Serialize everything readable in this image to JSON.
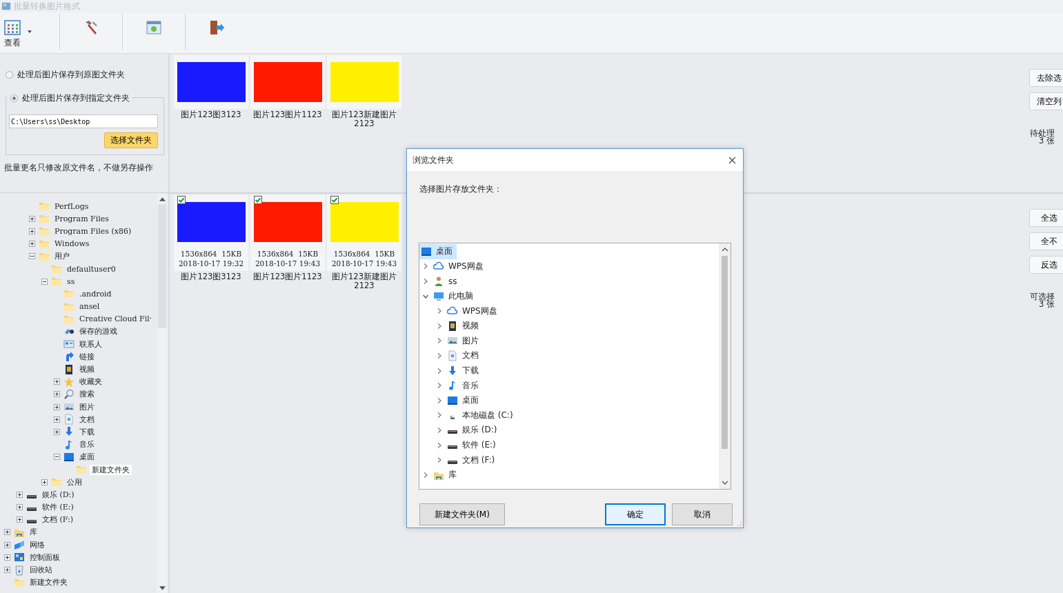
{
  "window": {
    "title": "批量转换图片格式"
  },
  "toolbar": {
    "items": [
      {
        "kind": "grid",
        "label": "查看",
        "dropdown": true
      },
      {
        "kind": "hammer"
      },
      {
        "kind": "board"
      },
      {
        "kind": "exit"
      }
    ]
  },
  "save_options": [
    {
      "label": "处理后图片保存到原图文件夹",
      "selected": false
    },
    {
      "label": "处理后图片保存到指定文件夹",
      "selected": true
    }
  ],
  "folder_field": {
    "value": "C:\\Users\\ss\\Desktop"
  },
  "choose_button": "选择文件夹",
  "note": "批量更名只修改原文件名，不做另存操作",
  "tree": {
    "items": [
      {
        "children": [
          {
            "children": [
              {
                "label": "PerfLogs",
                "kind": "folder",
                "selected": false
              },
              {
                "label": "Program Files",
                "kind": "folder",
                "expanded": false,
                "selected": false
              },
              {
                "label": "Program Files (x86)",
                "kind": "folder",
                "expanded": false,
                "selected": false
              },
              {
                "label": "Windows",
                "kind": "folder",
                "expanded": false,
                "selected": false
              },
              {
                "label": "用户",
                "kind": "folder",
                "expanded": true,
                "selected": false,
                "children": [
                  {
                    "label": "defaultuser0",
                    "kind": "folder",
                    "selected": false
                  },
                  {
                    "label": "ss",
                    "kind": "folder",
                    "expanded": true,
                    "selected": false,
                    "children": [
                      {
                        "label": ".android",
                        "kind": "folder",
                        "selected": false
                      },
                      {
                        "label": "ansel",
                        "kind": "folder",
                        "selected": false
                      },
                      {
                        "label": "Creative Cloud Fil·",
                        "kind": "folder",
                        "selected": false
                      },
                      {
                        "label": "保存的游戏",
                        "kind": "game",
                        "selected": false
                      },
                      {
                        "label": "联系人",
                        "kind": "contact",
                        "selected": false
                      },
                      {
                        "label": "链接",
                        "kind": "link",
                        "selected": false
                      },
                      {
                        "label": "视频",
                        "kind": "video",
                        "selected": false
                      },
                      {
                        "label": "收藏夹",
                        "kind": "star",
                        "expanded": false,
                        "selected": false
                      },
                      {
                        "label": "搜索",
                        "kind": "search",
                        "expanded": false,
                        "selected": false
                      },
                      {
                        "label": "图片",
                        "kind": "picture",
                        "expanded": false,
                        "selected": false
                      },
                      {
                        "label": "文档",
                        "kind": "doc",
                        "expanded": false,
                        "selected": false
                      },
                      {
                        "label": "下载",
                        "kind": "download",
                        "expanded": false,
                        "selected": false
                      },
                      {
                        "label": "音乐",
                        "kind": "music",
                        "selected": false
                      },
                      {
                        "label": "桌面",
                        "kind": "desktop",
                        "expanded": true,
                        "selected": false,
                        "children": [
                          {
                            "label": "新建文件夹",
                            "kind": "folder",
                            "selected": true
                          }
                        ]
                      }
                    ]
                  },
                  {
                    "label": "公用",
                    "kind": "folder",
                    "expanded": false,
                    "selected": false
                  }
                ]
              }
            ]
          },
          {
            "label": "娱乐 (D:)",
            "kind": "drive",
            "expanded": false,
            "selected": false
          },
          {
            "label": "软件 (E:)",
            "kind": "drive",
            "expanded": false,
            "selected": false
          },
          {
            "label": "文档 (F:)",
            "kind": "drive",
            "expanded": false,
            "selected": false
          }
        ]
      },
      {
        "label": "库",
        "kind": "library",
        "expanded": false,
        "selected": false
      },
      {
        "label": "网络",
        "kind": "network",
        "expanded": false,
        "selected": false
      },
      {
        "label": "控制面板",
        "kind": "control",
        "expanded": false,
        "selected": false
      },
      {
        "label": "回收站",
        "kind": "recycle",
        "expanded": false,
        "selected": false
      },
      {
        "label": "新建文件夹",
        "kind": "folder",
        "selected": false
      }
    ]
  },
  "pending": {
    "images": [
      {
        "color": "#1a1aff",
        "caption": "图片123图3123"
      },
      {
        "color": "#ff1a00",
        "caption": "图片123图片1123"
      },
      {
        "color": "#fff000",
        "caption": "图片123新建图片2123"
      }
    ],
    "buttons": [
      "去除选",
      "清空列"
    ],
    "count_label": "待处理",
    "count": "3 张"
  },
  "selectable": {
    "images": [
      {
        "color": "#1a1aff",
        "checked": true,
        "info": "1536x864  15KB",
        "date": "2018-10-17 19:32",
        "caption": "图片123图3123"
      },
      {
        "color": "#ff1a00",
        "checked": true,
        "info": "1536x864  15KB",
        "date": "2018-10-17 19:43",
        "caption": "图片123图片1123"
      },
      {
        "color": "#fff000",
        "checked": true,
        "info": "1536x864  15KB",
        "date": "2018-10-17 19:43",
        "caption": "图片123新建图片2123"
      }
    ],
    "buttons": [
      "全选",
      "全不",
      "反选"
    ],
    "count_label": "可选择",
    "count": "3 张"
  },
  "dialog": {
    "title": "浏览文件夹",
    "prompt": "选择图片存放文件夹：",
    "tree": [
      {
        "label": "桌面",
        "kind": "desktop",
        "selected": true,
        "children": [
          {
            "label": "WPS网盘",
            "kind": "cloud",
            "expanded": false,
            "selected": false
          },
          {
            "label": "ss",
            "kind": "user",
            "expanded": false,
            "selected": false
          },
          {
            "label": "此电脑",
            "kind": "computer",
            "expanded": true,
            "selected": false,
            "children": [
              {
                "label": "WPS网盘",
                "kind": "cloud",
                "expanded": false,
                "selected": false
              },
              {
                "label": "视频",
                "kind": "video",
                "expanded": false,
                "selected": false
              },
              {
                "label": "图片",
                "kind": "picture",
                "expanded": false,
                "selected": false
              },
              {
                "label": "文档",
                "kind": "doc",
                "expanded": false,
                "selected": false
              },
              {
                "label": "下载",
                "kind": "download",
                "expanded": false,
                "selected": false
              },
              {
                "label": "音乐",
                "kind": "music",
                "expanded": false,
                "selected": false
              },
              {
                "label": "桌面",
                "kind": "desktop",
                "expanded": false,
                "selected": false
              },
              {
                "label": "本地磁盘 (C:)",
                "kind": "sysdrive",
                "expanded": false,
                "selected": false
              },
              {
                "label": "娱乐 (D:)",
                "kind": "drive",
                "expanded": false,
                "selected": false
              },
              {
                "label": "软件 (E:)",
                "kind": "drive",
                "expanded": false,
                "selected": false
              },
              {
                "label": "文档 (F:)",
                "kind": "drive",
                "expanded": false,
                "selected": false
              }
            ]
          },
          {
            "label": "库",
            "kind": "library",
            "expanded": false,
            "selected": false
          }
        ]
      }
    ],
    "buttons": [
      {
        "label": "新建文件夹(M)",
        "focused": false
      },
      {
        "label": "确定",
        "focused": true
      },
      {
        "label": "取消",
        "focused": false
      }
    ]
  }
}
